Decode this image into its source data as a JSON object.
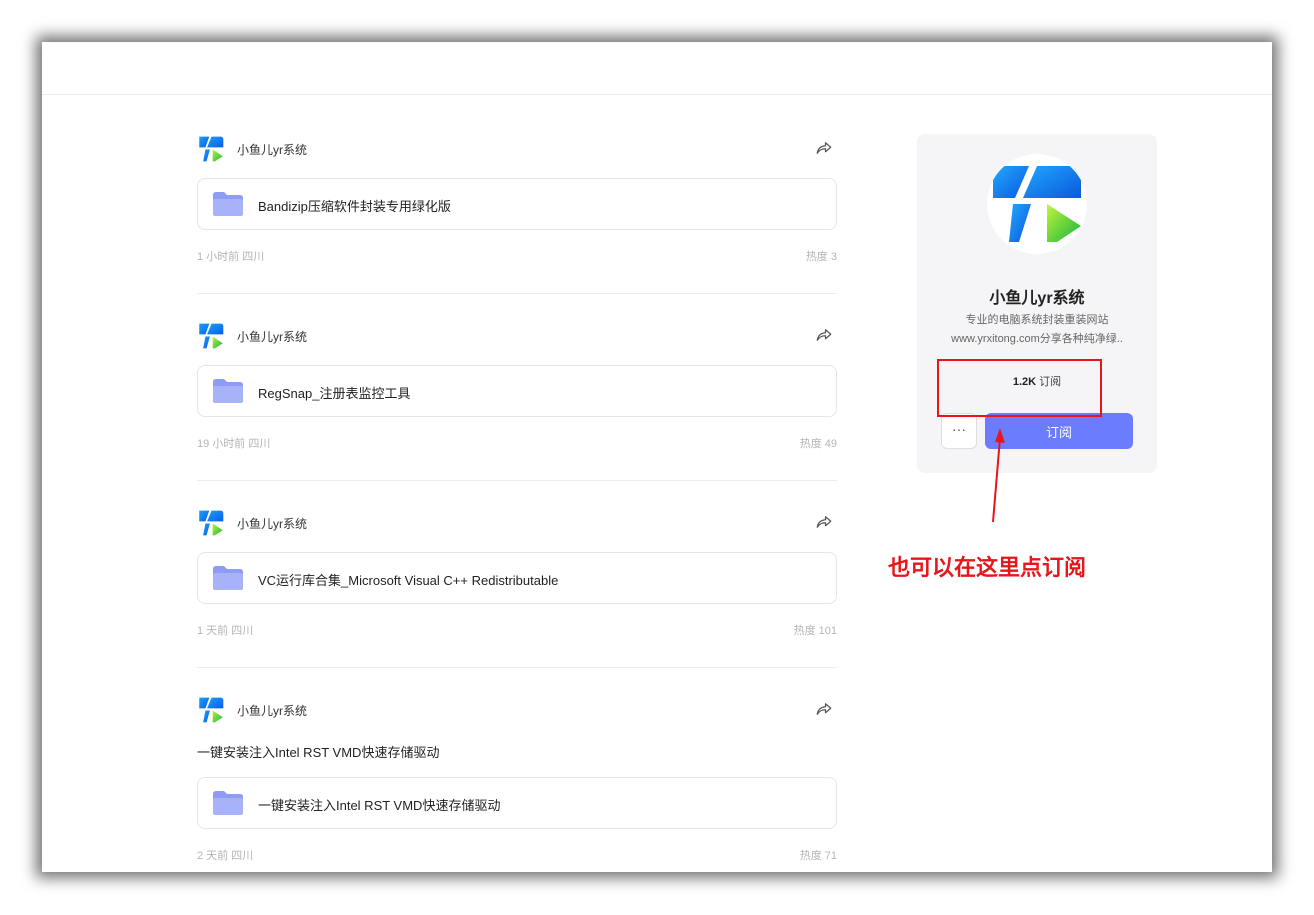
{
  "channel": {
    "name": "小鱼儿yr系统",
    "description_line1": "专业的电脑系统封装重装网站",
    "description_line2": "www.yrxitong.com分享各种纯净绿..",
    "subscriber_count": "1.2K",
    "subscriber_label": "订阅",
    "more_label": "···",
    "subscribe_label": "订阅"
  },
  "posts": [
    {
      "author": "小鱼儿yr系统",
      "text": "",
      "file_name": "Bandizip压缩软件封装专用绿化版",
      "time": "1 小时前 四川",
      "heat": "热度 3"
    },
    {
      "author": "小鱼儿yr系统",
      "text": "",
      "file_name": "RegSnap_注册表监控工具",
      "time": "19 小时前 四川",
      "heat": "热度 49"
    },
    {
      "author": "小鱼儿yr系统",
      "text": "",
      "file_name": "VC运行库合集_Microsoft Visual C++ Redistributable",
      "time": "1 天前 四川",
      "heat": "热度 101"
    },
    {
      "author": "小鱼儿yr系统",
      "text": "一键安装注入Intel RST VMD快速存储驱动",
      "file_name": "一键安装注入Intel RST VMD快速存储驱动",
      "time": "2 天前 四川",
      "heat": "热度 71"
    }
  ],
  "annotation": {
    "text": "也可以在这里点订阅",
    "color": "#e8161b"
  },
  "colors": {
    "accent": "#6b7cff",
    "annotation_red": "#e8161b",
    "folder": "#8f9cf5"
  }
}
